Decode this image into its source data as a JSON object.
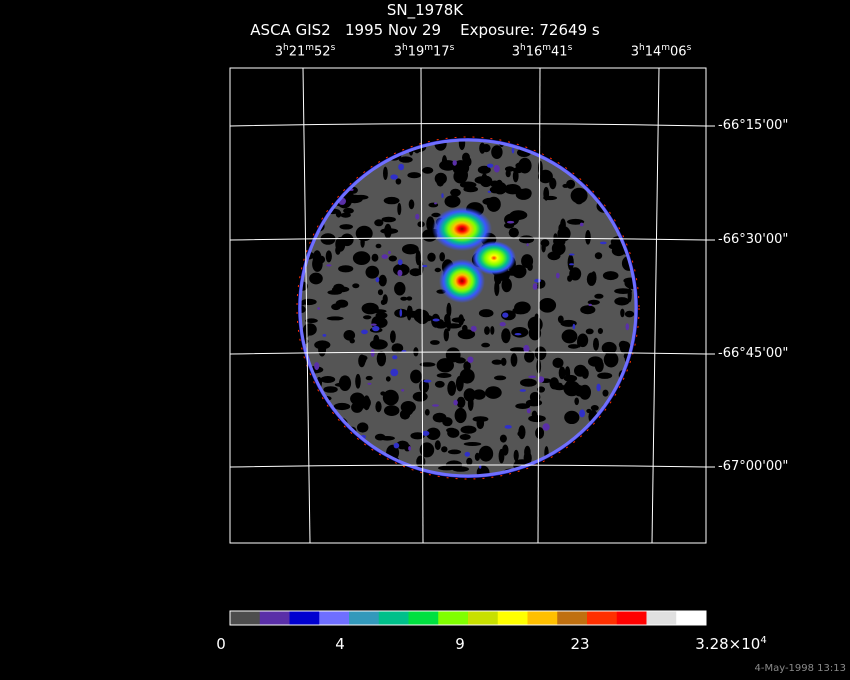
{
  "header": {
    "object": "SN_1978K",
    "info": "ASCA GIS2   1995 Nov 29    Exposure: 72649 s"
  },
  "ra_ticks": [
    {
      "h": "3",
      "m": "21",
      "s": "52"
    },
    {
      "h": "3",
      "m": "19",
      "s": "17"
    },
    {
      "h": "3",
      "m": "16",
      "s": "41"
    },
    {
      "h": "3",
      "m": "14",
      "s": "06"
    }
  ],
  "dec_ticks": [
    "-66°15'00\"",
    "-66°30'00\"",
    "-66°45'00\"",
    "-67°00'00\""
  ],
  "colorbar": {
    "colors": [
      "#4d4d4d",
      "#5a2fa8",
      "#0000d0",
      "#6f6fff",
      "#3399bb",
      "#00c08a",
      "#00e040",
      "#80ff00",
      "#c8e000",
      "#ffff00",
      "#ffc000",
      "#c07010",
      "#ff3000",
      "#ff0000",
      "#e0e0e0",
      "#ffffff"
    ],
    "tick_labels": [
      {
        "label": "0"
      },
      {
        "label": "4"
      },
      {
        "label": "9"
      },
      {
        "label": "23"
      },
      {
        "label": "3.28×10",
        "exp": "4"
      }
    ]
  },
  "chart_data": {
    "type": "heatmap",
    "title": "SN_1978K",
    "subtitle": "ASCA GIS2   1995 Nov 29    Exposure: 72649 s",
    "x_axis": {
      "type": "right ascension",
      "ticks": [
        "3h21m52s",
        "3h19m17s",
        "3h16m41s",
        "3h14m06s"
      ]
    },
    "y_axis": {
      "type": "declination",
      "ticks": [
        "-66°15'00\"",
        "-66°30'00\"",
        "-66°45'00\"",
        "-67°00'00\""
      ]
    },
    "color_scale": {
      "tick_values": [
        0,
        4,
        9,
        23,
        32800
      ],
      "tick_labels": [
        "0",
        "4",
        "9",
        "23",
        "3.28×10^4"
      ]
    },
    "sources": [
      {
        "name": "brightest",
        "peak_level": "red"
      },
      {
        "name": "middle",
        "peak_level": "yellow"
      },
      {
        "name": "lower",
        "peak_level": "red"
      }
    ],
    "grid": true
  },
  "footer": {
    "timestamp": "4-May-1998 13:13"
  }
}
